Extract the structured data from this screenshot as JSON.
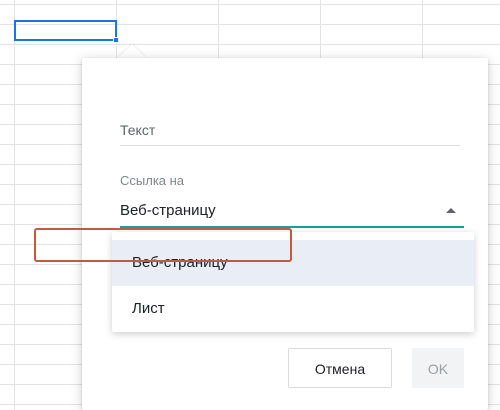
{
  "dialog": {
    "text_label": "Текст",
    "link_label": "Ссылка на",
    "selected_value": "Веб-страницу",
    "options": [
      {
        "label": "Веб-страницу",
        "highlighted": true
      },
      {
        "label": "Лист",
        "outlined": true
      }
    ],
    "cancel_label": "Отмена",
    "ok_label": "OK"
  },
  "colors": {
    "accent_underline": "#1a9f96",
    "selection_blue": "#1a73e8",
    "highlight_outline": "#c15a3e"
  }
}
